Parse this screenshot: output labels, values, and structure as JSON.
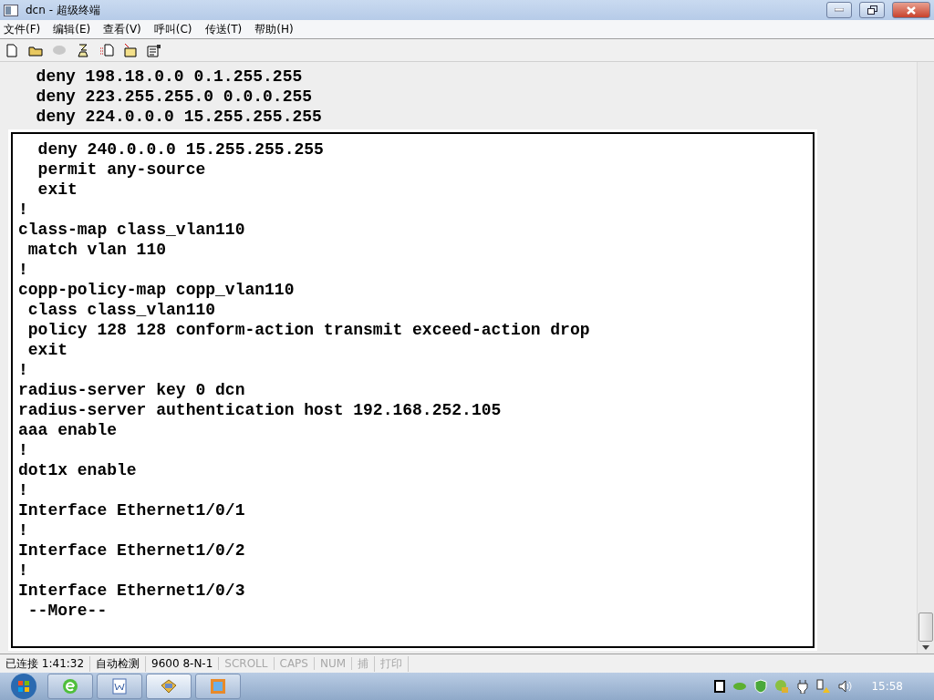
{
  "window": {
    "title": "dcn - 超级终端"
  },
  "menu": [
    {
      "label": "文件(F)"
    },
    {
      "label": "编辑(E)"
    },
    {
      "label": "查看(V)"
    },
    {
      "label": "呼叫(C)"
    },
    {
      "label": "传送(T)"
    },
    {
      "label": "帮助(H)"
    }
  ],
  "toolbar": [
    {
      "kind": "new",
      "disabled": false
    },
    {
      "kind": "open",
      "disabled": false
    },
    {
      "kind": "dial",
      "disabled": true
    },
    {
      "kind": "hangup",
      "disabled": false
    },
    {
      "kind": "send",
      "disabled": false
    },
    {
      "kind": "receive",
      "disabled": false
    },
    {
      "kind": "properties",
      "disabled": false
    }
  ],
  "terminal": {
    "lines": [
      "  deny 198.18.0.0 0.1.255.255",
      "  deny 223.255.255.0 0.0.0.255",
      "  deny 224.0.0.0 15.255.255.255"
    ]
  },
  "panel": {
    "lines": [
      "  deny 240.0.0.0 15.255.255.255",
      "  permit any-source",
      "  exit",
      "!",
      "class-map class_vlan110",
      " match vlan 110",
      "!",
      "copp-policy-map copp_vlan110",
      " class class_vlan110",
      " policy 128 128 conform-action transmit exceed-action drop",
      " exit",
      "!",
      "radius-server key 0 dcn",
      "radius-server authentication host 192.168.252.105",
      "aaa enable",
      "!",
      "dot1x enable",
      "!",
      "Interface Ethernet1/0/1",
      "!",
      "Interface Ethernet1/0/2",
      "!",
      "Interface Ethernet1/0/3",
      " --More--"
    ]
  },
  "status_bar": [
    {
      "text": "已连接 1:41:32",
      "active": true
    },
    {
      "text": "自动检测",
      "active": true
    },
    {
      "text": "9600 8-N-1",
      "active": true
    },
    {
      "text": "SCROLL",
      "active": false
    },
    {
      "text": "CAPS",
      "active": false
    },
    {
      "text": "NUM",
      "active": false
    },
    {
      "text": "捕",
      "active": false
    },
    {
      "text": "打印",
      "active": false
    }
  ],
  "taskbar": {
    "apps": [
      {
        "kind": "browser",
        "selected": false
      },
      {
        "kind": "word",
        "selected": false
      },
      {
        "kind": "terminal",
        "selected": true
      },
      {
        "kind": "window",
        "selected": false
      }
    ],
    "clock": "15:58"
  }
}
